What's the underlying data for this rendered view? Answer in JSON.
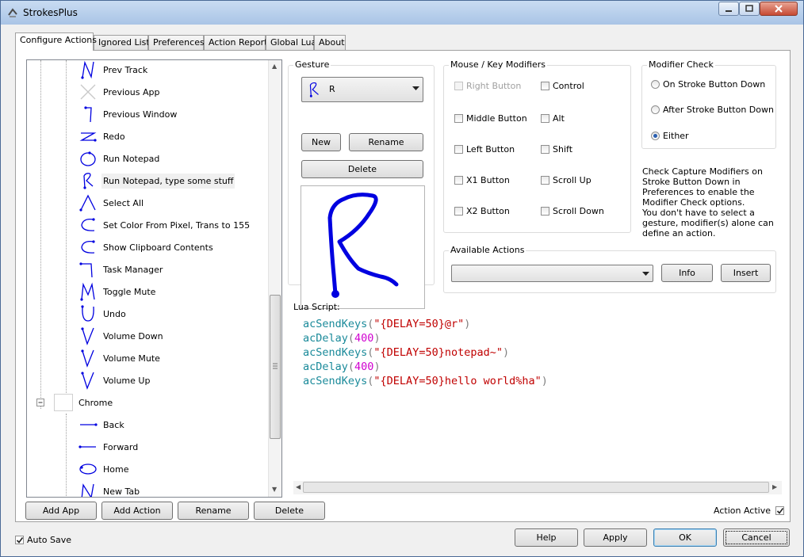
{
  "window": {
    "title": "StrokesPlus"
  },
  "tabs": [
    {
      "label": "Configure Actions"
    },
    {
      "label": "Ignored List"
    },
    {
      "label": "Preferences"
    },
    {
      "label": "Action Report"
    },
    {
      "label": "Global Lua"
    },
    {
      "label": "About"
    }
  ],
  "tree": {
    "items": [
      {
        "label": "Prev Track",
        "gesture": "prev-track-gesture"
      },
      {
        "label": "Previous App",
        "gesture": "x-gesture"
      },
      {
        "label": "Previous Window",
        "gesture": "hook-gesture"
      },
      {
        "label": "Redo",
        "gesture": "z-gesture"
      },
      {
        "label": "Run Notepad",
        "gesture": "circle-gesture"
      },
      {
        "label": "Run Notepad, type some stuff",
        "gesture": "r-gesture"
      },
      {
        "label": "Select All",
        "gesture": "a-gesture"
      },
      {
        "label": "Set Color From Pixel, Trans to 155",
        "gesture": "c-gesture"
      },
      {
        "label": "Show Clipboard Contents",
        "gesture": "c-gesture"
      },
      {
        "label": "Task Manager",
        "gesture": "t-gesture"
      },
      {
        "label": "Toggle Mute",
        "gesture": "m-gesture"
      },
      {
        "label": "Undo",
        "gesture": "u-gesture"
      },
      {
        "label": "Volume Down",
        "gesture": "v-gesture"
      },
      {
        "label": "Volume Mute",
        "gesture": "v-gesture"
      },
      {
        "label": "Volume Up",
        "gesture": "v-gesture"
      }
    ],
    "app": {
      "label": "Chrome"
    },
    "app_items": [
      {
        "label": "Back",
        "gesture": "left-line-gesture"
      },
      {
        "label": "Forward",
        "gesture": "right-line-gesture"
      },
      {
        "label": "Home",
        "gesture": "circle-gesture"
      },
      {
        "label": "New Tab",
        "gesture": "n-gesture"
      }
    ]
  },
  "bottom_buttons": {
    "add_app": "Add App",
    "add_action": "Add Action",
    "rename": "Rename",
    "delete": "Delete"
  },
  "gesture": {
    "group_label": "Gesture",
    "selected": "R",
    "new": "New",
    "rename": "Rename",
    "delete": "Delete"
  },
  "modifiers": {
    "group_label": "Mouse / Key Modifiers",
    "items": [
      {
        "label": "Right Button",
        "checked": false,
        "disabled": true
      },
      {
        "label": "Control",
        "checked": false
      },
      {
        "label": "Middle Button",
        "checked": false
      },
      {
        "label": "Alt",
        "checked": false
      },
      {
        "label": "Left Button",
        "checked": false
      },
      {
        "label": "Shift",
        "checked": false
      },
      {
        "label": "X1 Button",
        "checked": false
      },
      {
        "label": "Scroll Up",
        "checked": false
      },
      {
        "label": "X2 Button",
        "checked": false
      },
      {
        "label": "Scroll Down",
        "checked": false
      }
    ]
  },
  "modifier_check": {
    "group_label": "Modifier Check",
    "options": [
      {
        "label": "On Stroke Button Down",
        "selected": false
      },
      {
        "label": "After Stroke Button Down",
        "selected": false
      },
      {
        "label": "Either",
        "selected": true
      }
    ],
    "note1": "Check Capture Modifiers on Stroke Button Down in Preferences to enable the Modifier Check options.",
    "note2": "You don't have to select a gesture, modifier(s) alone can define an action."
  },
  "available_actions": {
    "group_label": "Available Actions",
    "selected": "",
    "info": "Info",
    "insert": "Insert"
  },
  "lua": {
    "label": "Lua Script:",
    "lines": [
      {
        "fn": "acSendKeys",
        "open": "(",
        "arg": "\"{DELAY=50}@r\"",
        "close": ")",
        "type": "str"
      },
      {
        "fn": "acDelay",
        "open": "(",
        "arg": "400",
        "close": ")",
        "type": "num"
      },
      {
        "fn": "acSendKeys",
        "open": "(",
        "arg": "\"{DELAY=50}notepad~\"",
        "close": ")",
        "type": "str"
      },
      {
        "fn": "acDelay",
        "open": "(",
        "arg": "400",
        "close": ")",
        "type": "num"
      },
      {
        "fn": "acSendKeys",
        "open": "(",
        "arg": "\"{DELAY=50}hello world%ha\"",
        "close": ")",
        "type": "str"
      }
    ]
  },
  "action_active": {
    "label": "Action Active",
    "checked": true
  },
  "footer": {
    "auto_save": {
      "label": "Auto Save",
      "checked": true
    },
    "help": "Help",
    "apply": "Apply",
    "ok": "OK",
    "cancel": "Cancel"
  },
  "colors": {
    "gesture_stroke": "#0000e0",
    "accent": "#2a5fb0"
  }
}
